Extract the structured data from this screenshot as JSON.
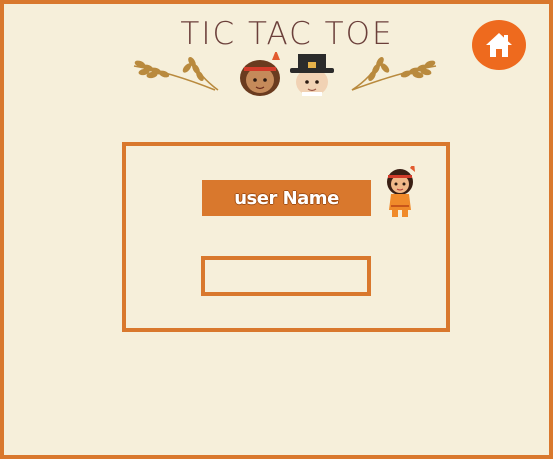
{
  "header": {
    "title": "TIC TAC TOE"
  },
  "icons": {
    "home": "home-icon",
    "wheat_left": "wheat-left-icon",
    "wheat_right": "wheat-right-icon",
    "native_child": "native-child-icon",
    "pilgrim": "pilgrim-icon",
    "mascot": "native-girl-icon"
  },
  "form": {
    "label": "user Name",
    "input_value": "",
    "input_placeholder": ""
  },
  "colors": {
    "background": "#f6efda",
    "accent": "#d9782d",
    "home_button": "#ee6a1e",
    "title": "#6b3f3a"
  }
}
